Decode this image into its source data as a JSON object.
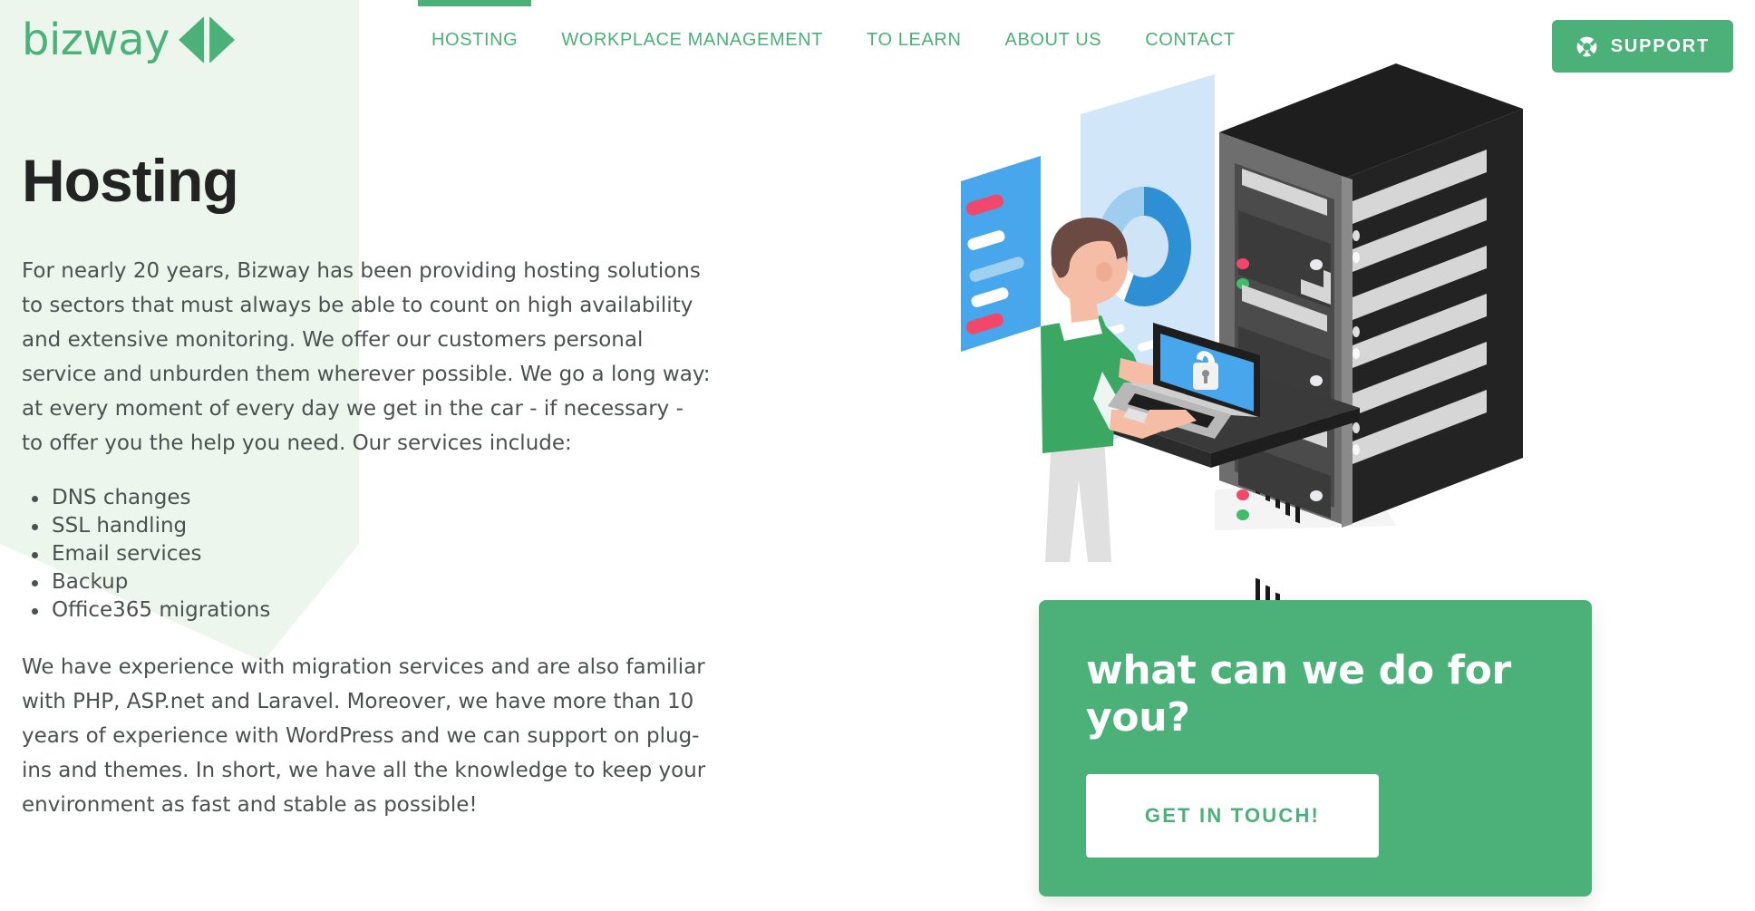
{
  "brand": {
    "logo_text": "bizway",
    "accent_color": "#4cb178",
    "panel_color": "#edf6ed"
  },
  "nav": {
    "items": [
      {
        "label": "HOSTING",
        "active": true
      },
      {
        "label": "WORKPLACE MANAGEMENT",
        "active": false
      },
      {
        "label": "TO LEARN",
        "active": false
      },
      {
        "label": "ABOUT US",
        "active": false
      },
      {
        "label": "CONTACT",
        "active": false
      }
    ]
  },
  "support": {
    "label": "SUPPORT",
    "icon": "lifebuoy-icon"
  },
  "main": {
    "title": "Hosting",
    "paragraph_1": "For nearly 20 years, Bizway has been providing hosting solutions to sectors that must always be able to count on high availability and extensive monitoring. We offer our customers personal service and unburden them wherever possible. We go a long way: at every moment of every day we get in the car - if necessary - to offer you the help you need. Our services include:",
    "services": [
      "DNS changes",
      "SSL handling",
      "Email services",
      "Backup",
      "Office365 migrations"
    ],
    "paragraph_2": "We have experience with migration services and are also familiar with PHP, ASP.net and Laravel. Moreover, we have more than 10 years of experience with WordPress and we can support on plug-ins and themes. In short, we have all the knowledge to keep your environment as fast and stable as possible!"
  },
  "cta": {
    "title": "what can we do for you?",
    "button_label": "GET IN TOUCH!"
  },
  "illustration": {
    "name": "server-rack-technician-illustration",
    "elements": [
      "server-rack",
      "technician-person",
      "laptop-with-padlock",
      "holographic-dashboard-panel",
      "donut-chart",
      "status-leds"
    ]
  }
}
